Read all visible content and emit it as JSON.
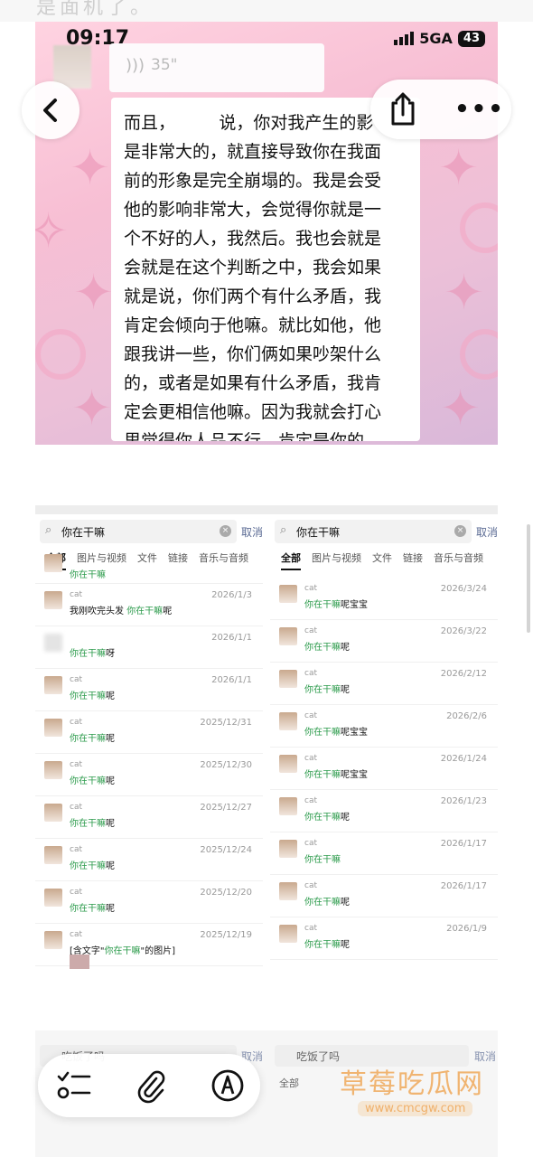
{
  "top_fade_text": "是面机了。",
  "panel1": {
    "status_time": "09:17",
    "network": "5GA",
    "battery": "43",
    "voice_duration": "35\"",
    "transcript": "而且，        说，你对我产生的影\n是非常大的，就直接导致你在我面\n前的形象是完全崩塌的。我是会受\n他的影响非常大，会觉得你就是一\n个不好的人，我然后。我也会就是\n会就是在这个判断之中，我会如果\n就是说，你们两个有什么矛盾，我\n肯定会倾向于他嘛。就比如他，他\n跟我讲一些，你们俩如果吵架什么\n的，或者是如果有什么矛盾，我肯\n定会更相信他嘛。因为我就会打心\n里觉得你人品不行，肯定是你的\n错。"
  },
  "viewer": {
    "back_icon": "chevron-left-icon",
    "share_icon": "share-icon",
    "more_label": "•••"
  },
  "panel2": {
    "left": {
      "query": "你在干嘛",
      "cancel": "取消",
      "tabs": [
        "全部",
        "图片与视频",
        "文件",
        "链接",
        "音乐与音频"
      ],
      "partial_top": "你在干嘛",
      "items": [
        {
          "name": "cat",
          "pre": "我刚吹完头发 ",
          "hl": "你在干嘛",
          "post": "呢",
          "date": "2026/1/3"
        },
        {
          "name": "",
          "pre": "",
          "hl": "你在干嘛",
          "post": "呀",
          "date": "2026/1/1",
          "blur": true
        },
        {
          "name": "cat",
          "pre": "",
          "hl": "你在干嘛",
          "post": "呢",
          "date": "2026/1/1"
        },
        {
          "name": "cat",
          "pre": "",
          "hl": "你在干嘛",
          "post": "呢",
          "date": "2025/12/31"
        },
        {
          "name": "cat",
          "pre": "",
          "hl": "你在干嘛",
          "post": "呢",
          "date": "2025/12/30"
        },
        {
          "name": "cat",
          "pre": "",
          "hl": "你在干嘛",
          "post": "呢",
          "date": "2025/12/27"
        },
        {
          "name": "cat",
          "pre": "",
          "hl": "你在干嘛",
          "post": "呢",
          "date": "2025/12/24"
        },
        {
          "name": "cat",
          "pre": "",
          "hl": "你在干嘛",
          "post": "呢",
          "date": "2025/12/20"
        },
        {
          "name": "cat",
          "pre": "[含文字\"",
          "hl": "你在干嘛",
          "post": "\"的图片]",
          "date": "2025/12/19",
          "thumb": true
        }
      ]
    },
    "right": {
      "query": "你在干嘛",
      "cancel": "取消",
      "tabs": [
        "全部",
        "图片与视频",
        "文件",
        "链接",
        "音乐与音频"
      ],
      "items": [
        {
          "name": "cat",
          "pre": "",
          "hl": "你在干嘛",
          "post": "呢宝宝",
          "date": "2026/3/24"
        },
        {
          "name": "cat",
          "pre": "",
          "hl": "你在干嘛",
          "post": "呢",
          "date": "2026/3/22"
        },
        {
          "name": "cat",
          "pre": "",
          "hl": "你在干嘛",
          "post": "呢",
          "date": "2026/2/12"
        },
        {
          "name": "cat",
          "pre": "",
          "hl": "你在干嘛",
          "post": "呢宝宝",
          "date": "2026/2/6"
        },
        {
          "name": "cat",
          "pre": "",
          "hl": "你在干嘛",
          "post": "呢宝宝",
          "date": "2026/1/24"
        },
        {
          "name": "cat",
          "pre": "",
          "hl": "你在干嘛",
          "post": "呢",
          "date": "2026/1/23"
        },
        {
          "name": "cat",
          "pre": "",
          "hl": "你在干嘛",
          "post": "",
          "date": "2026/1/17"
        },
        {
          "name": "cat",
          "pre": "",
          "hl": "你在干嘛",
          "post": "呢",
          "date": "2026/1/17"
        },
        {
          "name": "cat",
          "pre": "",
          "hl": "你在干嘛",
          "post": "呢",
          "date": "2026/1/9"
        }
      ]
    }
  },
  "panel3": {
    "left_query": "吃饭了吗",
    "right_query": "吃饭了吗",
    "cancel": "取消",
    "tab_all": "全部"
  },
  "bottom_bar": {
    "checklist_icon": "checklist-icon",
    "attach_icon": "paperclip-icon",
    "markup_icon": "markup-pen-icon"
  },
  "watermark": {
    "text": "草莓吃瓜网",
    "url": "www.cmcgw.com"
  }
}
